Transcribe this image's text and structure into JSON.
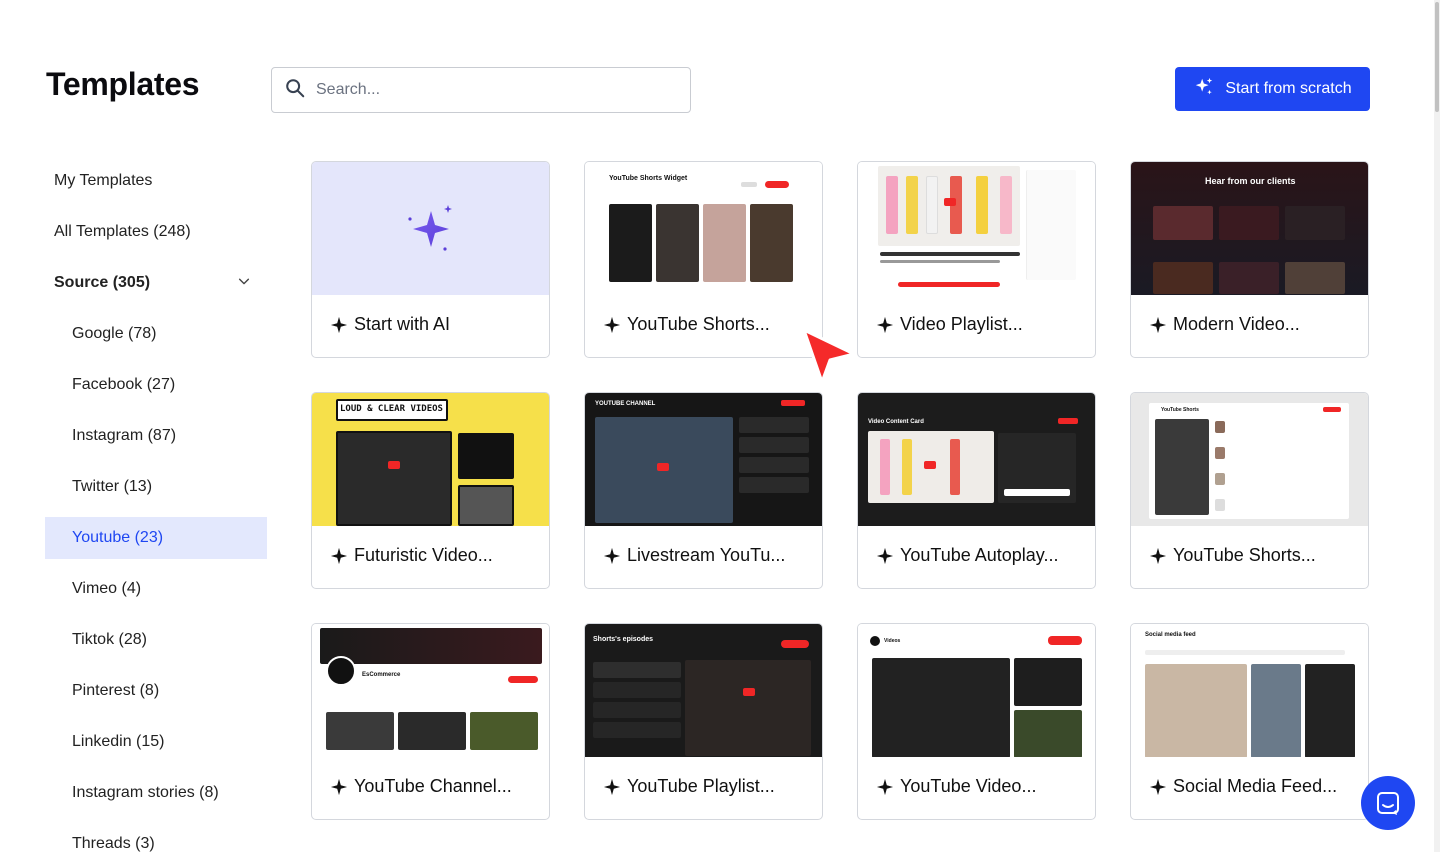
{
  "page": {
    "title": "Templates"
  },
  "search": {
    "placeholder": "Search..."
  },
  "header": {
    "start_from_scratch_label": "Start from scratch"
  },
  "sidebar": {
    "my_templates": "My Templates",
    "all_templates": "All Templates (248)",
    "source": "Source (305)",
    "sources": [
      "Google (78)",
      "Facebook (27)",
      "Instagram (87)",
      "Twitter (13)",
      "Youtube (23)",
      "Vimeo (4)",
      "Tiktok (28)",
      "Pinterest (8)",
      "Linkedin (15)",
      "Instagram stories (8)",
      "Threads (3)"
    ],
    "active_source": "Youtube (23)"
  },
  "cards": [
    {
      "label": "Start with AI"
    },
    {
      "label": "YouTube Shorts...",
      "thumb_title": "YouTube Shorts Widget"
    },
    {
      "label": "Video Playlist..."
    },
    {
      "label": "Modern Video...",
      "thumb_title": "Hear from our clients"
    },
    {
      "label": "Futuristic Video...",
      "thumb_title": "LOUD & CLEAR VIDEOS"
    },
    {
      "label": "Livestream YouTu...",
      "thumb_title": "YOUTUBE CHANNEL"
    },
    {
      "label": "YouTube Autoplay...",
      "thumb_title": "Video Content Card"
    },
    {
      "label": "YouTube Shorts...",
      "thumb_title": "YouTube Shorts"
    },
    {
      "label": "YouTube Channel...",
      "thumb_title": "EsCommerce"
    },
    {
      "label": "YouTube Playlist...",
      "thumb_title": "Shorts's episodes"
    },
    {
      "label": "YouTube Video...",
      "thumb_title": "Videos"
    },
    {
      "label": "Social Media Feed...",
      "thumb_title": "Social media feed"
    }
  ],
  "colors": {
    "accent": "#1f47f2",
    "active_bg": "#e3e8fd",
    "ai_thumb_bg": "#e4e6fb",
    "youtube_red": "#f02626",
    "cursor_red": "#f52a2a"
  }
}
